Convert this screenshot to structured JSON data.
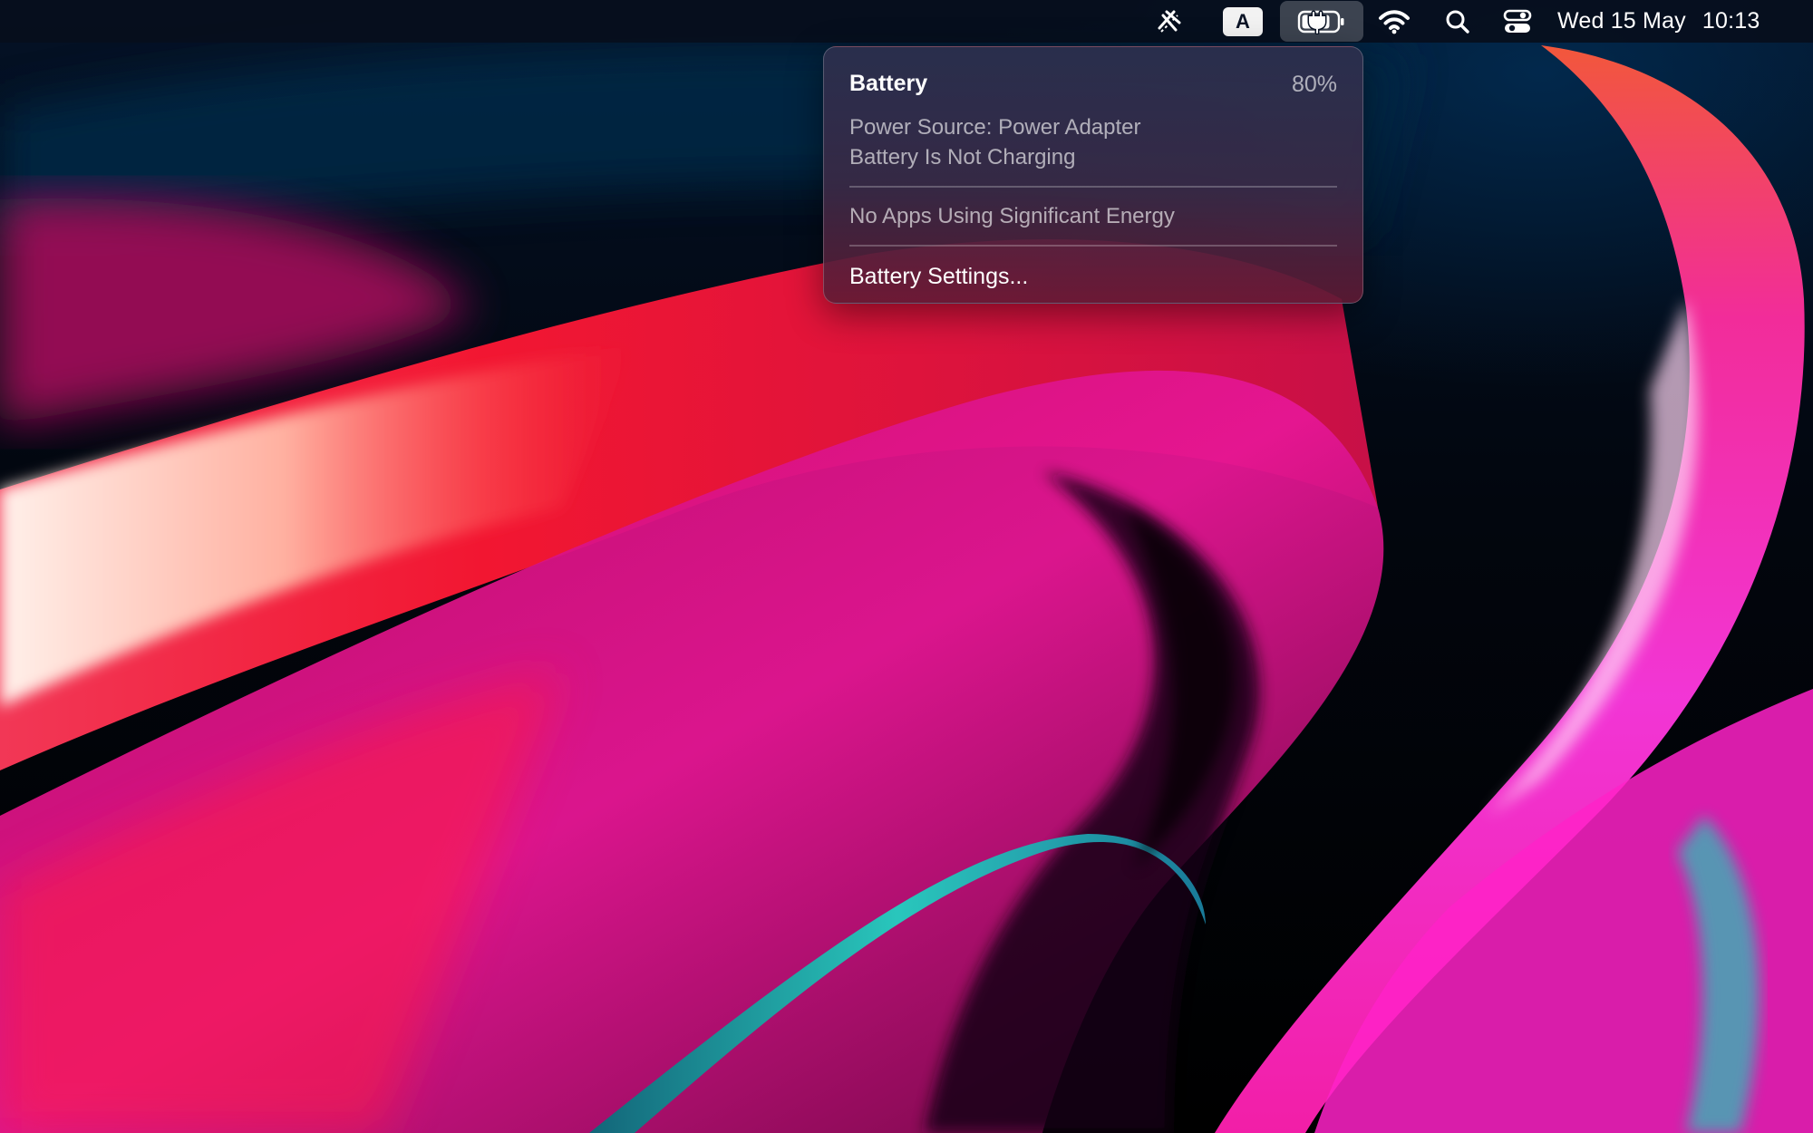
{
  "menubar": {
    "icons": {
      "vpn": "vpn-status-icon",
      "input_source": "input-source-icon",
      "battery": "battery-charging-icon",
      "wifi": "wifi-icon",
      "search": "spotlight-search-icon",
      "control_center": "control-center-icon"
    },
    "input_source_letter": "A",
    "clock": {
      "date": "Wed 15 May",
      "time": "10:13"
    }
  },
  "battery_menu": {
    "title": "Battery",
    "percent": "80%",
    "level": 0.8,
    "power_source": "Power Source: Power Adapter",
    "status": "Battery Is Not Charging",
    "energy_note": "No Apps Using Significant Energy",
    "settings_label": "Battery Settings..."
  },
  "colors": {
    "menubar_bg": "#060e1c",
    "wallpaper_red": "#ff1a3c",
    "wallpaper_magenta": "#e0108a",
    "wallpaper_cyan": "#1fc9c0",
    "wallpaper_pink": "#ff4fe0"
  }
}
